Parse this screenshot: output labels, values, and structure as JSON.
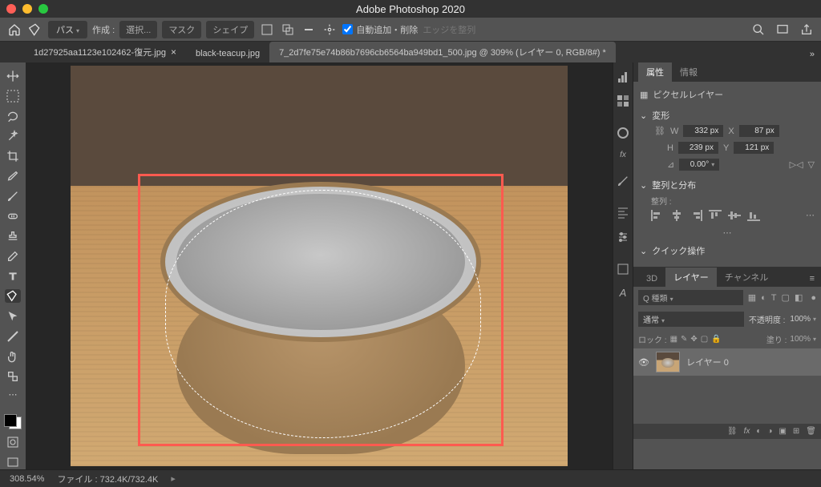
{
  "app": {
    "title": "Adobe Photoshop 2020"
  },
  "traffic_colors": [
    "#ff5f57",
    "#febc2e",
    "#28c840"
  ],
  "menubar": {
    "path_label": "パス",
    "create_label": "作成 :",
    "select_label": "選択...",
    "mask_label": "マスク",
    "shape_label": "シェイプ",
    "auto_label": "自動追加・削除",
    "edge_label": "エッジを整列"
  },
  "tabs": [
    {
      "label": "1d27925aa1123e102462-復元.jpg",
      "active": false
    },
    {
      "label": "black-teacup.jpg",
      "active": false
    },
    {
      "label": "7_2d7fe75e74b86b7696cb6564ba949bd1_500.jpg @ 309% (レイヤー 0, RGB/8#) *",
      "active": true
    }
  ],
  "properties": {
    "tab_attr": "属性",
    "tab_info": "情報",
    "layer_type": "ピクセルレイヤー",
    "transform_label": "変形",
    "W": "332 px",
    "X": "87 px",
    "H": "239 px",
    "Y": "121 px",
    "angle": "0.00°",
    "align_label": "整列と分布",
    "align_sub": "整列 :",
    "quick_label": "クイック操作"
  },
  "layers": {
    "tab_3d": "3D",
    "tab_layers": "レイヤー",
    "tab_channels": "チャンネル",
    "search_kind": "Q 種類",
    "blend_mode": "通常",
    "opacity_label": "不透明度 :",
    "opacity_val": "100%",
    "lock_label": "ロック :",
    "fill_label": "塗り :",
    "fill_val": "100%",
    "layer_name": "レイヤー 0"
  },
  "status": {
    "zoom": "308.54%",
    "file": "ファイル : 732.4K/732.4K"
  }
}
